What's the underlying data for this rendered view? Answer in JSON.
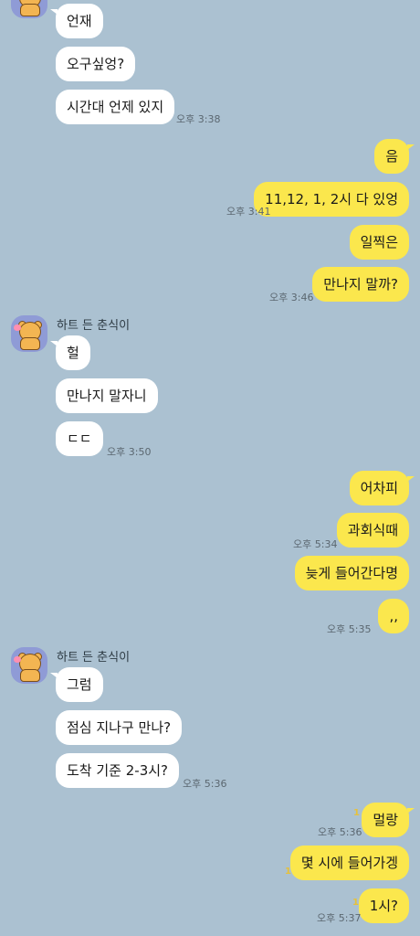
{
  "chat": {
    "sender_name": "하트 든 춘식이",
    "messages": [
      {
        "text": "언재"
      },
      {
        "text": "오구싶엉?"
      },
      {
        "text": "시간대 언제 있지",
        "time": "오후 3:38"
      },
      {
        "text": "음"
      },
      {
        "text": "11,12, 1, 2시 다 있엉",
        "time": "오후 3:41"
      },
      {
        "text": "일찍은"
      },
      {
        "text": "만나지 말까?",
        "time": "오후 3:46"
      },
      {
        "text": "헐"
      },
      {
        "text": "만나지 말자니"
      },
      {
        "text": "ㄷㄷ",
        "time": "오후 3:50"
      },
      {
        "text": "어차피"
      },
      {
        "text": "과회식때",
        "time": "오후 5:34"
      },
      {
        "text": "늦게 들어간다명"
      },
      {
        "text": ",,",
        "time": "오후 5:35"
      },
      {
        "text": "그럼"
      },
      {
        "text": "점심 지나구 만나?"
      },
      {
        "text": "도착 기준 2-3시?",
        "time": "오후 5:36"
      },
      {
        "text": "멀랑",
        "time": "오후 5:36",
        "unread": "1"
      },
      {
        "text": "몇 시에 들어가겡",
        "unread": "1"
      },
      {
        "text": "1시?",
        "time": "오후 5:37",
        "unread": "1"
      }
    ]
  }
}
